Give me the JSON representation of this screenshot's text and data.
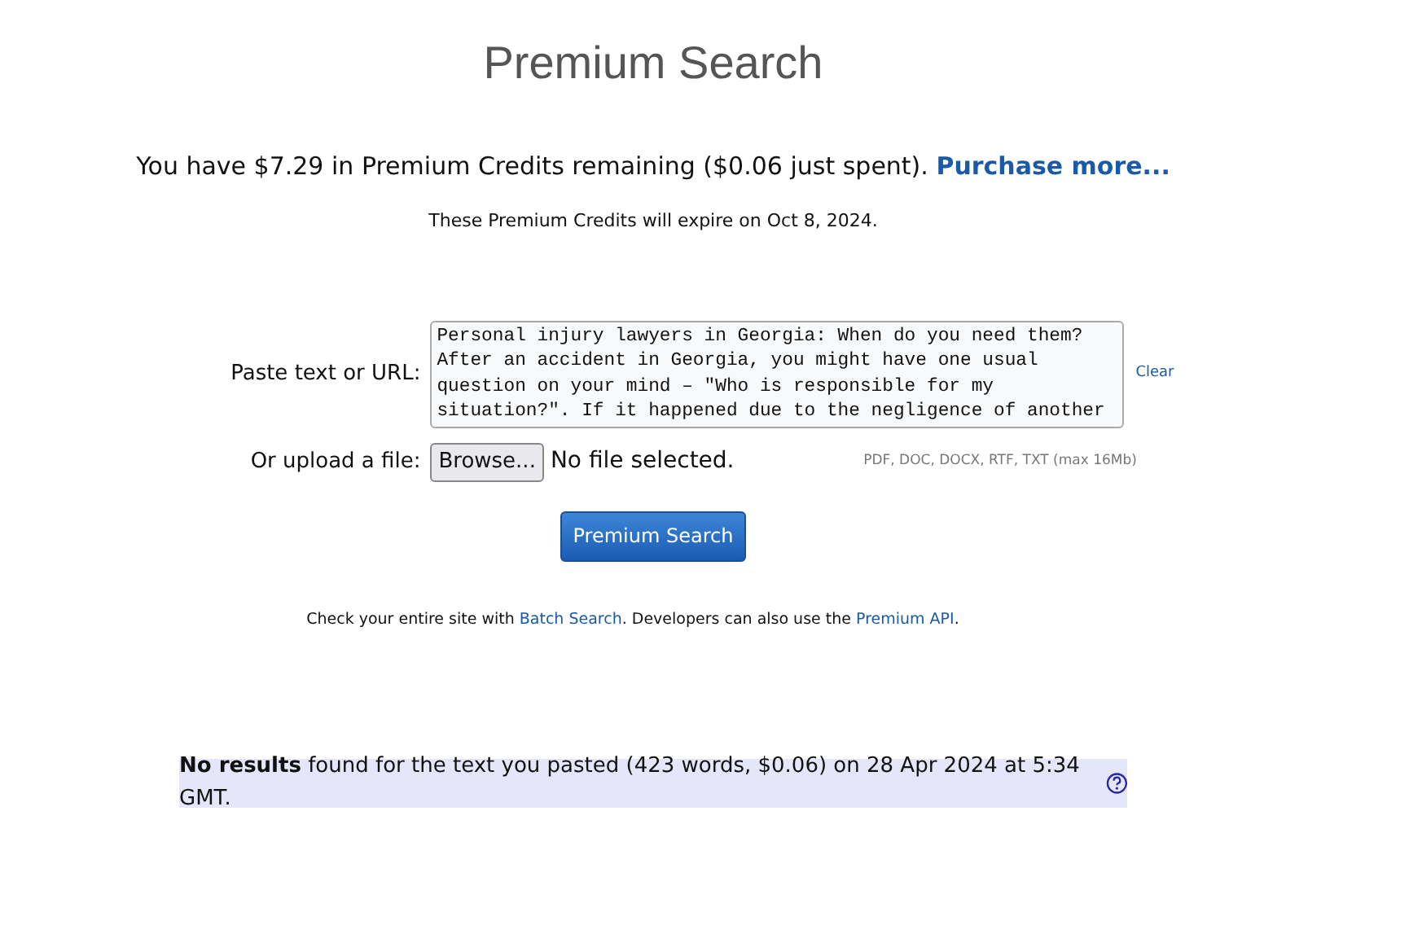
{
  "title": "Premium Search",
  "credits": {
    "text": "You have $7.29 in Premium Credits remaining ($0.06 just spent).",
    "link": "Purchase more..."
  },
  "expiry": "These Premium Credits will expire on Oct 8, 2024.",
  "form": {
    "text_label": "Paste text or URL:",
    "text_value": "Personal injury lawyers in Georgia: When do you need them?\nAfter an accident in Georgia, you might have one usual\nquestion on your mind – \"Who is responsible for my\nsituation?\". If it happened due to the negligence of another",
    "clear": "Clear",
    "file_label": "Or upload a file:",
    "browse": "Browse...",
    "file_status": "No file selected.",
    "file_hint": "PDF, DOC, DOCX, RTF, TXT (max 16Mb)"
  },
  "search_button": "Premium Search",
  "info": {
    "before": "Check your entire site with",
    "link1": "Batch Search",
    "middle": ". Developers can also use the",
    "link2": "Premium API",
    "after": "."
  },
  "result": "**No results** found for the text you pasted (423 words, $0.06) on 28 Apr 2024 at 5:34 GMT."
}
